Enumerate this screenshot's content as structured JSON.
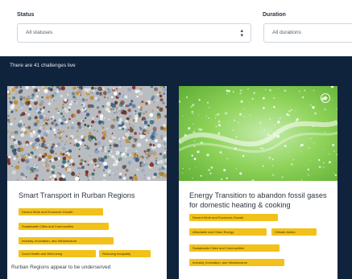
{
  "filters": {
    "status": {
      "label": "Status",
      "value": "All statuses"
    },
    "duration": {
      "label": "Duration",
      "value": "All durations"
    }
  },
  "summary": "There are 41 challenges live",
  "cards": [
    {
      "title": "Smart Transport in Rurban Regions",
      "tags": [
        "Decent Work and Economic Growth",
        "Sustainable Cities and Communities",
        "Industry, Innovation, and Infrastructure",
        "Good Health and Well-being",
        "Reducing Inequality"
      ],
      "description": "Rurban Regions appear to be underserved"
    },
    {
      "title": "Energy Transition to abandon fossil gases for domestic heating & cooking",
      "tags": [
        "Decent Work and Economic Growth",
        "Affordable and Clean Energy",
        "Climate Action",
        "Sustainable Cities and Communities",
        "Industry, Innovation, and Infrastructure"
      ]
    }
  ],
  "colors": {
    "banner": "#10233d",
    "tag": "#f2c11a",
    "card2_image": "#7dc246"
  },
  "icons": {
    "select_caret": "updown-caret-icon",
    "favorite": "favorite-icon"
  }
}
